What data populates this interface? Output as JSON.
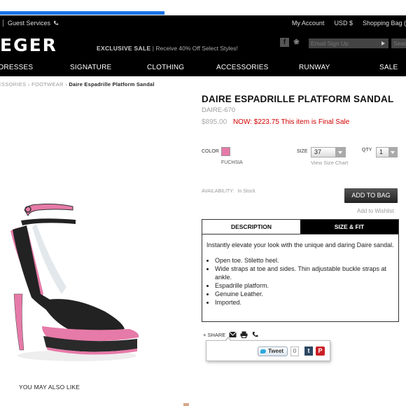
{
  "topbar": {
    "guest_services": "Guest Services",
    "my_account": "My Account",
    "currency": "USD $",
    "shopping_bag": "Shopping Bag ("
  },
  "header": {
    "logo": "EGER",
    "promo_bold": "EXCLUSIVE SALE",
    "promo_rest": " | Receive 40% Off Select Styles!",
    "email_placeholder": "Email Sign Up",
    "search_placeholder": "Search"
  },
  "nav": {
    "items": [
      "DRESSES",
      "SIGNATURE",
      "CLOTHING",
      "ACCESSORIES",
      "RUNWAY",
      "SALE"
    ]
  },
  "breadcrumb": {
    "accessories": "ACCESSORIES",
    "footwear": "FOOTWEAR",
    "current": "Daire Espadrille Platform Sandal"
  },
  "product": {
    "title": "DAIRE ESPADRILLE PLATFORM SANDAL",
    "sku": "DAIRE-670",
    "original_price": "$895.00",
    "sale_price": "NOW: $223.75 This item is Final Sale",
    "color_label": "COLOR",
    "color_name": "FUCHSIA",
    "color_hex": "#e67aa8",
    "size_label": "SIZE",
    "size_value": "37",
    "size_chart": "View Size Chart",
    "qty_label": "QTY",
    "qty_value": "1",
    "availability_label": "AVAILABILITY:",
    "availability_value": "In Stock",
    "add_to_bag": "ADD TO BAG",
    "add_to_wishlist": "Add to Wishlist"
  },
  "tabs": {
    "description": "DESCRIPTION",
    "size_fit": "SIZE & FIT"
  },
  "description": {
    "intro": "Instantly elevate your look with the unique and daring Daire sandal.",
    "bullets": [
      "Open toe. Stiletto heel.",
      "Wide straps at toe and sides. Thin adjustable buckle straps at ankle.",
      "Espadrille platform.",
      "Genuine Leather.",
      "Imported."
    ]
  },
  "share": {
    "label": "+ SHARE",
    "tweet": "Tweet",
    "tweet_count": "0",
    "tumblr": "t",
    "pinterest": "P"
  },
  "also_like": "YOU MAY ALSO LIKE",
  "colors": {
    "accent_blue": "#1a73e8",
    "sale_red": "#d10000",
    "shoe_pink": "#e67aa8"
  }
}
